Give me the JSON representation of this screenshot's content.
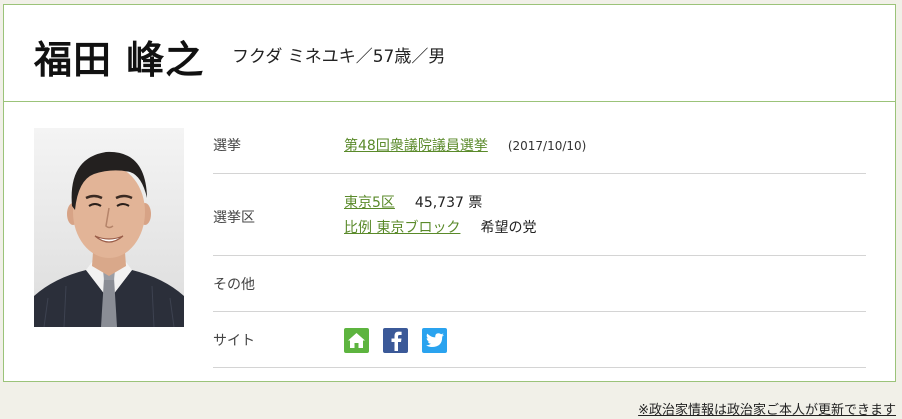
{
  "politician": {
    "name": "福田 峰之",
    "kana_age_gender": "フクダ ミネユキ／57歳／男"
  },
  "rows": {
    "election": {
      "label": "選挙",
      "name": "第48回衆議院議員選挙",
      "date": "(2017/10/10)"
    },
    "district": {
      "label": "選挙区",
      "district_name": "東京5区",
      "votes": "45,737 票",
      "pr_block": "比例 東京ブロック",
      "party": "希望の党"
    },
    "other": {
      "label": "その他"
    },
    "site": {
      "label": "サイト",
      "icons": [
        "home-icon",
        "facebook-icon",
        "twitter-icon"
      ]
    }
  },
  "footer": {
    "note": "※政治家情報は政治家ご本人が更新できます"
  },
  "colors": {
    "border_green": "#9bc379",
    "link_green": "#5a8a2a",
    "home": "#5db43f",
    "facebook": "#3b5998",
    "twitter": "#2aa3ef"
  }
}
